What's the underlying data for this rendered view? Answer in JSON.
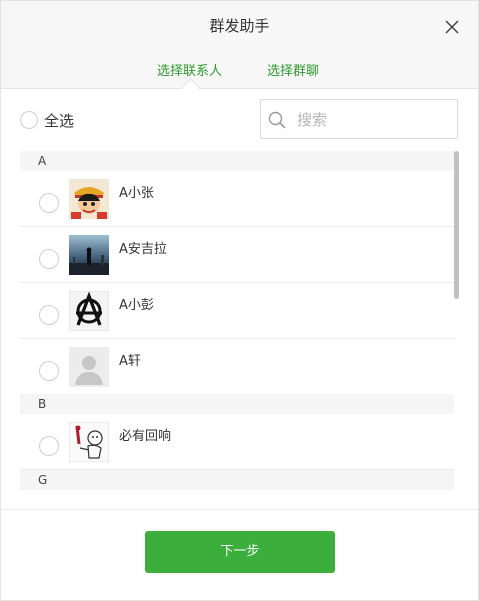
{
  "dialog": {
    "title": "群发助手",
    "close_icon": "close-icon"
  },
  "tabs": [
    {
      "label": "选择联系人",
      "active": true
    },
    {
      "label": "选择群聊",
      "active": false
    }
  ],
  "select_all": {
    "label": "全选",
    "checked": false
  },
  "search": {
    "placeholder": "搜索",
    "value": "",
    "icon": "search-icon"
  },
  "groups": [
    {
      "letter": "A",
      "contacts": [
        {
          "name": "A小张",
          "avatar": "cartoon-pirate-avatar"
        },
        {
          "name": "A安吉拉",
          "avatar": "night-scenery-avatar"
        },
        {
          "name": "A小彭",
          "avatar": "anarchy-symbol-avatar"
        },
        {
          "name": "A轩",
          "avatar": "default-user-avatar"
        }
      ]
    },
    {
      "letter": "B",
      "contacts": [
        {
          "name": "必有回响",
          "avatar": "sketch-figure-avatar"
        }
      ]
    },
    {
      "letter": "G",
      "contacts": []
    }
  ],
  "footer": {
    "next_label": "下一步"
  },
  "colors": {
    "accent": "#3bae3b",
    "tab_active": "#2f9a2f",
    "header_bg": "#f7f7f7"
  }
}
